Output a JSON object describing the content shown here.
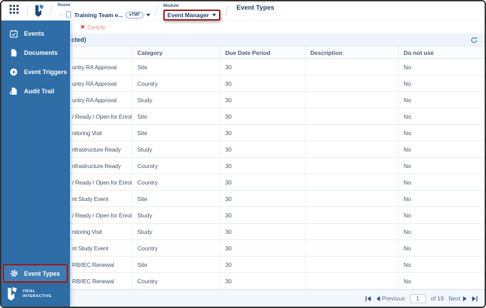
{
  "header": {
    "room_label": "Room",
    "room_name": "Training Team e...",
    "room_badge": "eTMF",
    "module_label": "Module",
    "module_value": "Event Manager",
    "page_title": "Event Types"
  },
  "sidebar": {
    "items": [
      {
        "id": "events",
        "label": "Events"
      },
      {
        "id": "documents",
        "label": "Documents"
      },
      {
        "id": "event-triggers",
        "label": "Event Triggers"
      },
      {
        "id": "audit-trail",
        "label": "Audit Trail"
      }
    ],
    "selected_item": {
      "id": "event-types",
      "label": "Event Types"
    },
    "logo_text_line1": "TRIAL",
    "logo_text_line2": "INTERACTIVE"
  },
  "toolbar": {
    "delete_label": "Delete",
    "selection_text": "cted)"
  },
  "table": {
    "columns": [
      "",
      "Category",
      "Due Date Period",
      "Description",
      "Do not use"
    ],
    "rows": [
      {
        "name": "untry RA Approval",
        "category": "Site",
        "due_date_period": "30",
        "description": "",
        "do_not_use": "No"
      },
      {
        "name": "untry RA Approval",
        "category": "Country",
        "due_date_period": "30",
        "description": "",
        "do_not_use": "No"
      },
      {
        "name": "untry RA Approval",
        "category": "Study",
        "due_date_period": "30",
        "description": "",
        "do_not_use": "No"
      },
      {
        "name": "/ Ready / Open for Enrol...",
        "category": "Site",
        "due_date_period": "30",
        "description": "",
        "do_not_use": "No"
      },
      {
        "name": "nitoring Visit",
        "category": "Site",
        "due_date_period": "30",
        "description": "",
        "do_not_use": "No"
      },
      {
        "name": "nfrastructure Ready",
        "category": "Study",
        "due_date_period": "30",
        "description": "",
        "do_not_use": "No"
      },
      {
        "name": "nfrastructure Ready",
        "category": "Country",
        "due_date_period": "30",
        "description": "",
        "do_not_use": "No"
      },
      {
        "name": "/ Ready / Open for Enrol...",
        "category": "Country",
        "due_date_period": "30",
        "description": "",
        "do_not_use": "No"
      },
      {
        "name": "nt Study Event",
        "category": "Site",
        "due_date_period": "30",
        "description": "",
        "do_not_use": "No"
      },
      {
        "name": "/ Ready / Open for Enrol...",
        "category": "Study",
        "due_date_period": "30",
        "description": "",
        "do_not_use": "No"
      },
      {
        "name": "nitoring Visit",
        "category": "Study",
        "due_date_period": "30",
        "description": "",
        "do_not_use": "No"
      },
      {
        "name": "nt Study Event",
        "category": "Country",
        "due_date_period": "30",
        "description": "",
        "do_not_use": "No"
      },
      {
        "name": "RB/IEC Renewal",
        "category": "Site",
        "due_date_period": "30",
        "description": "",
        "do_not_use": "No"
      },
      {
        "name": "RB/IEC Renewal",
        "category": "Country",
        "due_date_period": "30",
        "description": "",
        "do_not_use": "No"
      }
    ]
  },
  "pagination": {
    "previous_label": "Previous",
    "page_value": "1",
    "of_label": "of 19",
    "next_label": "Next"
  },
  "colors": {
    "sidebar_blue": "#2e6da6",
    "sidebar_selected_blue": "#3f7cb5",
    "annotation_red": "#9b1b1b",
    "header_navy": "#1c3e6e",
    "delete_red": "#e23c36",
    "refresh_blue": "#4d80c4"
  }
}
